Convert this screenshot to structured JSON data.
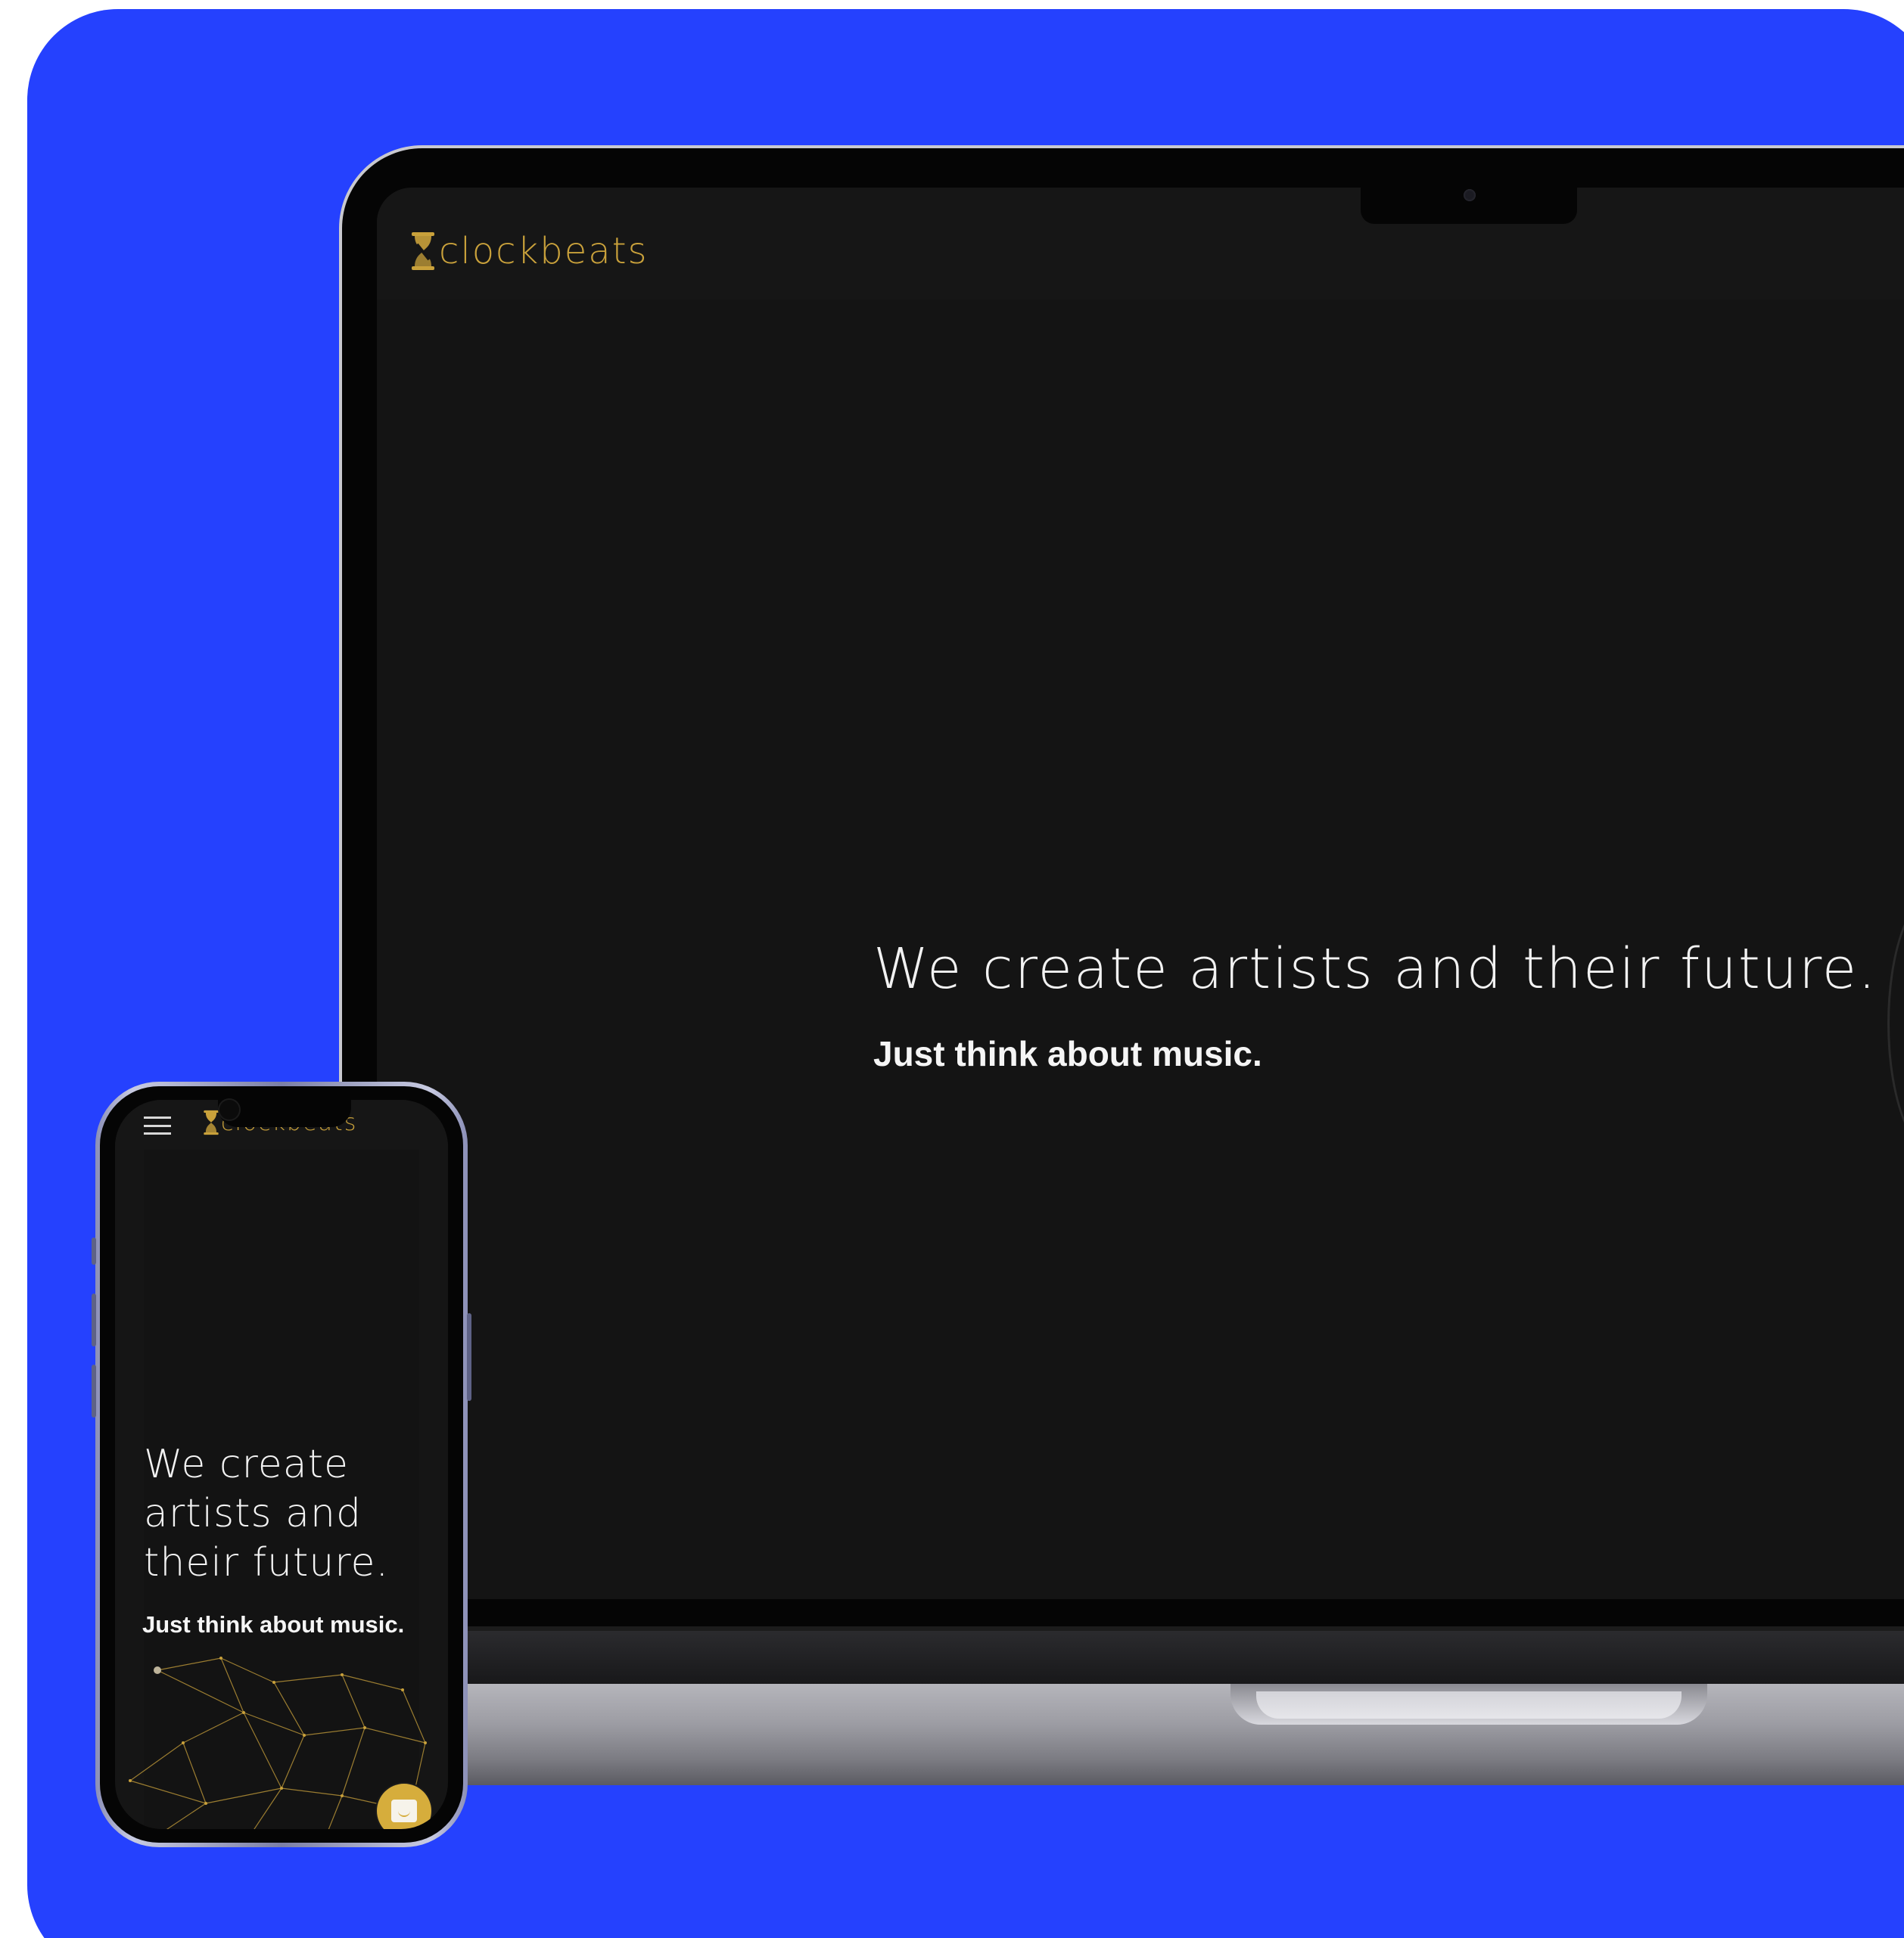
{
  "colors": {
    "backdrop": "#ffffff",
    "panel_blue": "#2541fe",
    "screen_bg": "#141414",
    "accent_gold": "#c9a13b",
    "text": "#f2f2f2"
  },
  "laptop": {
    "brand": {
      "logo_icon": "hourglass-icon",
      "name": "clockbeats"
    },
    "hero": {
      "headline": "We create artists and their future.",
      "tagline": "Just think about music."
    }
  },
  "phone": {
    "menu_icon": "hamburger-menu-icon",
    "brand": {
      "logo_icon": "hourglass-icon",
      "name": "clockbeats"
    },
    "hero": {
      "headline": "We create artists and their future.",
      "tagline": "Just think about music."
    },
    "chat_icon": "chat-icon"
  }
}
